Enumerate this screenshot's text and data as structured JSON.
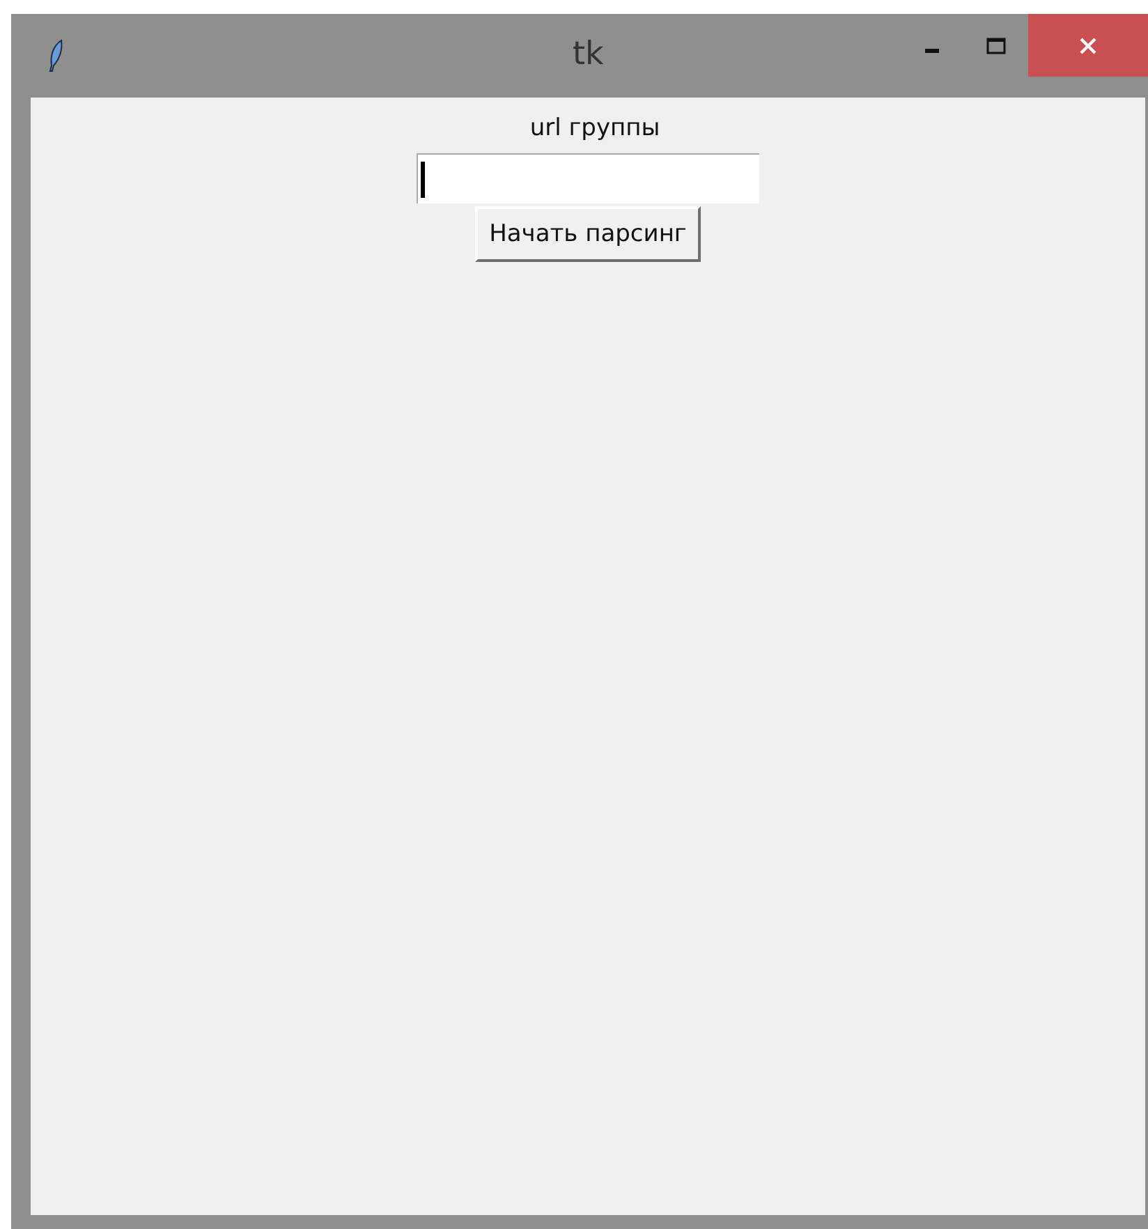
{
  "window": {
    "title": "tk"
  },
  "form": {
    "label": "url группы",
    "url_field": {
      "focused": true
    },
    "start_button": "Начать парсинг"
  }
}
